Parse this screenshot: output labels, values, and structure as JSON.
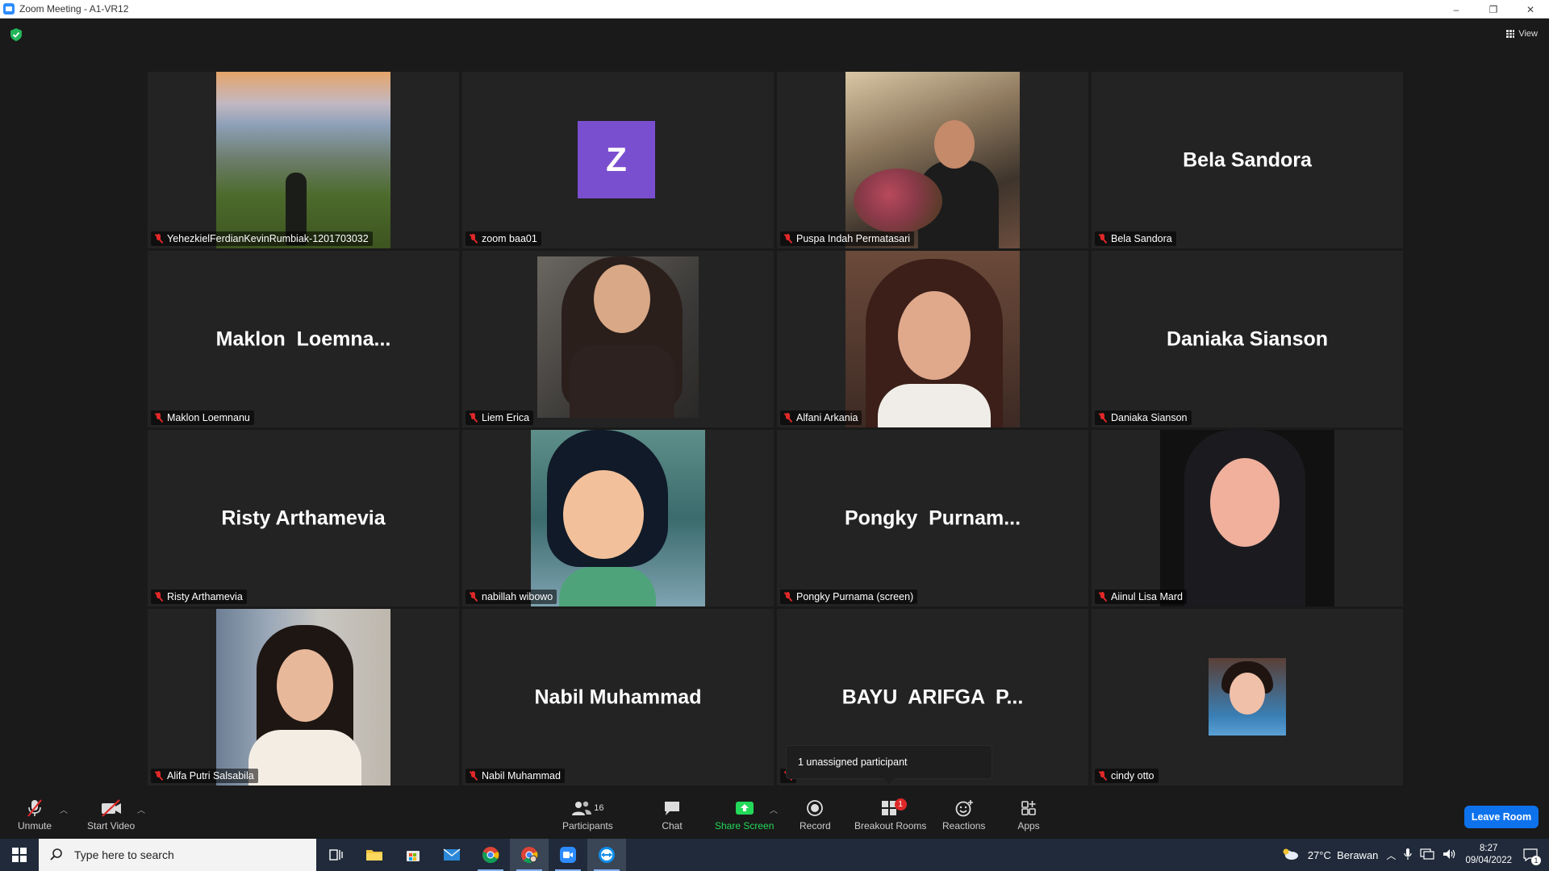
{
  "window": {
    "title": "Zoom Meeting - A1-VR12",
    "minimize": "–",
    "restore": "❐",
    "close": "✕"
  },
  "top": {
    "view_label": "View"
  },
  "participants": [
    {
      "tile_name": "YehezkielFerdianKevinRumbiak-1201703032",
      "display": "photo",
      "photo": "landscape"
    },
    {
      "tile_name": "zoom baa01",
      "display": "avatar",
      "avatar_letter": "Z"
    },
    {
      "tile_name": "Puspa Indah Permatasari",
      "display": "photo",
      "photo": "cafe"
    },
    {
      "tile_name": "Bela Sandora",
      "display": "name",
      "big_name": "Bela Sandora"
    },
    {
      "tile_name": "Maklon Loemnanu",
      "display": "name",
      "big_name": "Maklon  Loemna..."
    },
    {
      "tile_name": "Liem Erica",
      "display": "photo",
      "photo": "girl1"
    },
    {
      "tile_name": "Alfani Arkania",
      "display": "photo",
      "photo": "girl2"
    },
    {
      "tile_name": "Daniaka Sianson",
      "display": "name",
      "big_name": "Daniaka Sianson"
    },
    {
      "tile_name": "Risty Arthamevia",
      "display": "name",
      "big_name": "Risty Arthamevia"
    },
    {
      "tile_name": "nabillah wibowo",
      "display": "photo",
      "photo": "fairy"
    },
    {
      "tile_name": "Pongky Purnama (screen)",
      "display": "name",
      "big_name": "Pongky  Purnam..."
    },
    {
      "tile_name": "Aiinul Lisa Mard",
      "display": "photo",
      "photo": "hijab"
    },
    {
      "tile_name": "Alifa Putri Salsabila",
      "display": "photo",
      "photo": "office"
    },
    {
      "tile_name": "Nabil Muhammad",
      "display": "name",
      "big_name": "Nabil Muhammad"
    },
    {
      "tile_name": "",
      "display": "name",
      "big_name": "BAYU  ARIFGA  P..."
    },
    {
      "tile_name": "cindy otto",
      "display": "photo",
      "photo": "small"
    }
  ],
  "tooltip": {
    "text": "1 unassigned participant"
  },
  "toolbar": {
    "unmute": "Unmute",
    "start_video": "Start Video",
    "participants": "Participants",
    "participants_count": "16",
    "chat": "Chat",
    "share_screen": "Share Screen",
    "record": "Record",
    "breakout_rooms": "Breakout Rooms",
    "breakout_badge": "1",
    "reactions": "Reactions",
    "apps": "Apps",
    "leave": "Leave Room",
    "share_color": "#23d959",
    "leave_color": "#0e72ed",
    "mute_color": "#e02828"
  },
  "taskbar": {
    "search_placeholder": "Type here to search",
    "weather": "27°C  Berawan",
    "time": "8:27",
    "date": "09/04/2022",
    "notification_count": "1"
  }
}
